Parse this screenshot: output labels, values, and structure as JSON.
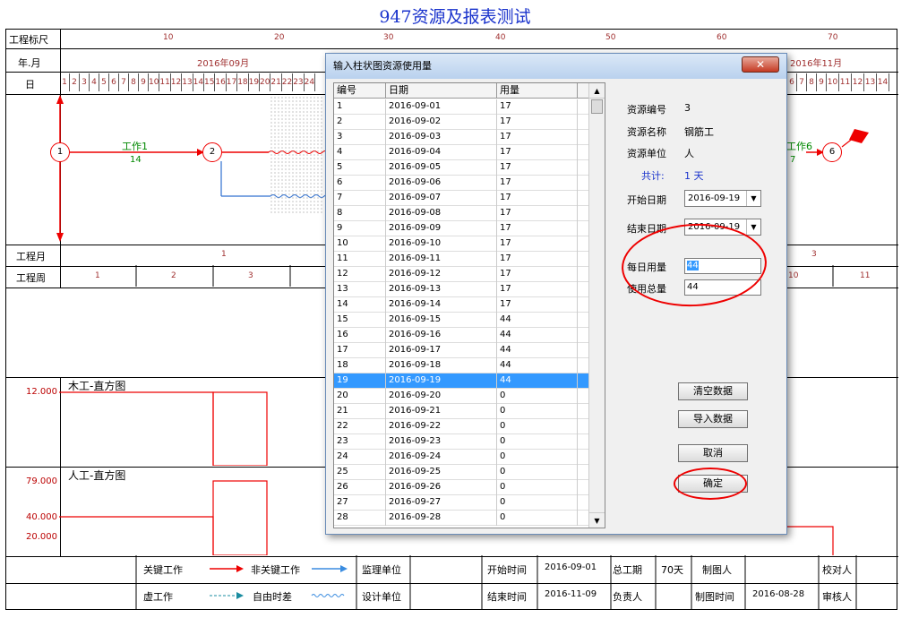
{
  "title": "947资源及报表测试",
  "header": {
    "ruler_label": "工程标尺",
    "ruler_ticks": [
      "10",
      "20",
      "30",
      "40",
      "50",
      "60",
      "70"
    ],
    "month_label": "年.月",
    "month_left": "2016年09月",
    "month_right": "2016年11月",
    "day_label": "日",
    "days_left": [
      "1",
      "2",
      "3",
      "4",
      "5",
      "6",
      "7",
      "8",
      "9",
      "10",
      "11",
      "12",
      "13",
      "14",
      "15",
      "16",
      "17",
      "18",
      "19",
      "20",
      "21",
      "22",
      "23",
      "24"
    ],
    "days_right": [
      "6",
      "7",
      "8",
      "9",
      "10",
      "11",
      "12",
      "13",
      "14"
    ]
  },
  "network": {
    "nodes": [
      "1",
      "2",
      "6"
    ],
    "work1_label": "工作1",
    "work1_duration": "14",
    "work6_label": "工作6",
    "work6_duration": "7"
  },
  "rows": {
    "project_month_label": "工程月",
    "project_month_left": "1",
    "project_month_right": "3",
    "project_week_label": "工程周",
    "weeks_left": [
      "1",
      "2",
      "3"
    ],
    "weeks_right": [
      "10",
      "11"
    ]
  },
  "charts": {
    "carpenter_title": "木工-直方图",
    "carpenter_y": "12.000",
    "labor_title": "人工-直方图",
    "labor_y1": "79.000",
    "labor_y2": "40.000",
    "labor_y3": "20.000"
  },
  "footer": {
    "critical": "关键工作",
    "noncritical": "非关键工作",
    "dummy": "虚工作",
    "freefloat": "自由时差",
    "supervisor": "监理单位",
    "designer": "设计单位",
    "start_label": "开始时间",
    "start_value": "2016-09-01",
    "end_label": "结束时间",
    "end_value": "2016-11-09",
    "total_label": "总工期",
    "total_value": "70天",
    "owner_label": "负责人",
    "drawer_label": "制图人",
    "drawtime_label": "制图时间",
    "drawtime_value": "2016-08-28",
    "checker_label": "校对人",
    "reviewer_label": "审核人"
  },
  "dialog": {
    "title": "输入柱状图资源使用量",
    "close": "✕",
    "columns": [
      "编号",
      "日期",
      "用量"
    ],
    "rows": [
      [
        "1",
        "2016-09-01",
        "17"
      ],
      [
        "2",
        "2016-09-02",
        "17"
      ],
      [
        "3",
        "2016-09-03",
        "17"
      ],
      [
        "4",
        "2016-09-04",
        "17"
      ],
      [
        "5",
        "2016-09-05",
        "17"
      ],
      [
        "6",
        "2016-09-06",
        "17"
      ],
      [
        "7",
        "2016-09-07",
        "17"
      ],
      [
        "8",
        "2016-09-08",
        "17"
      ],
      [
        "9",
        "2016-09-09",
        "17"
      ],
      [
        "10",
        "2016-09-10",
        "17"
      ],
      [
        "11",
        "2016-09-11",
        "17"
      ],
      [
        "12",
        "2016-09-12",
        "17"
      ],
      [
        "13",
        "2016-09-13",
        "17"
      ],
      [
        "14",
        "2016-09-14",
        "17"
      ],
      [
        "15",
        "2016-09-15",
        "44"
      ],
      [
        "16",
        "2016-09-16",
        "44"
      ],
      [
        "17",
        "2016-09-17",
        "44"
      ],
      [
        "18",
        "2016-09-18",
        "44"
      ],
      [
        "19",
        "2016-09-19",
        "44"
      ],
      [
        "20",
        "2016-09-20",
        "0"
      ],
      [
        "21",
        "2016-09-21",
        "0"
      ],
      [
        "22",
        "2016-09-22",
        "0"
      ],
      [
        "23",
        "2016-09-23",
        "0"
      ],
      [
        "24",
        "2016-09-24",
        "0"
      ],
      [
        "25",
        "2016-09-25",
        "0"
      ],
      [
        "26",
        "2016-09-26",
        "0"
      ],
      [
        "27",
        "2016-09-27",
        "0"
      ],
      [
        "28",
        "2016-09-28",
        "0"
      ]
    ],
    "selected_row": 19,
    "resource_no_label": "资源编号",
    "resource_no": "3",
    "resource_name_label": "资源名称",
    "resource_name": "钢筋工",
    "resource_unit_label": "资源单位",
    "resource_unit": "人",
    "total_label": "共计:",
    "total_value": "1 天",
    "start_label": "开始日期",
    "start_value": "2016-09-19",
    "end_label": "结束日期",
    "end_value": "2016-09-19",
    "daily_label": "每日用量",
    "daily_value": "44",
    "sum_label": "使用总量",
    "sum_value": "44",
    "clear_btn": "清空数据",
    "import_btn": "导入数据",
    "cancel_btn": "取消",
    "ok_btn": "确定"
  }
}
